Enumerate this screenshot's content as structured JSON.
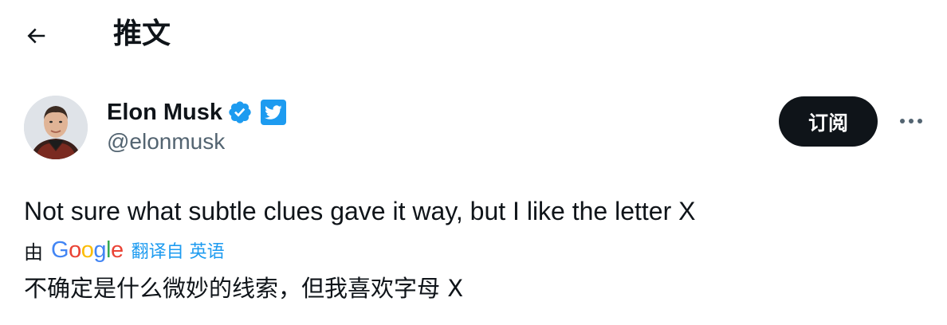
{
  "header": {
    "back_icon": "arrow-left-icon",
    "title": "推文"
  },
  "author": {
    "name": "Elon Musk",
    "handle": "@elonmusk",
    "verified_icon": "verified-badge-icon",
    "affiliate_icon": "twitter-bird-icon",
    "avatar": "avatar-photo"
  },
  "actions": {
    "subscribe_label": "订阅",
    "more_icon": "ellipsis-icon"
  },
  "tweet": {
    "text": "Not sure what subtle clues gave it way, but I like the letter X"
  },
  "translation": {
    "prefix": "由",
    "provider_logo": {
      "letters": [
        "G",
        "o",
        "o",
        "g",
        "l",
        "e"
      ],
      "colors": [
        "#4285F4",
        "#EA4335",
        "#FBBC05",
        "#4285F4",
        "#34A853",
        "#EA4335"
      ]
    },
    "link_label": "翻译自 英语",
    "translated_text": "不确定是什么微妙的线索，但我喜欢字母 X"
  },
  "colors": {
    "text_primary": "#0f1419",
    "text_secondary": "#536471",
    "accent": "#1d9bf0",
    "button_dark": "#0f1419"
  }
}
